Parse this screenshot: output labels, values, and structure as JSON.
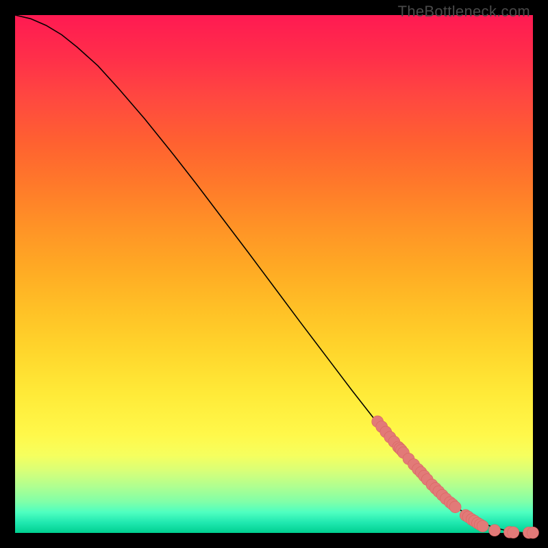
{
  "watermark": "TheBottleneck.com",
  "chart_data": {
    "type": "line",
    "title": "",
    "xlabel": "",
    "ylabel": "",
    "xlim": [
      0,
      100
    ],
    "ylim": [
      0,
      100
    ],
    "grid": false,
    "curve_x": [
      0,
      3,
      6,
      9,
      12,
      16,
      20,
      25,
      30,
      35,
      40,
      45,
      50,
      55,
      60,
      65,
      70,
      75,
      80,
      83,
      86,
      89,
      92,
      95,
      98,
      100
    ],
    "curve_y": [
      100,
      99.3,
      98.0,
      96.2,
      93.8,
      90.2,
      85.8,
      80.0,
      73.8,
      67.4,
      60.8,
      54.2,
      47.5,
      40.8,
      34.2,
      27.6,
      21.2,
      15.2,
      9.6,
      6.8,
      4.4,
      2.6,
      1.2,
      0.4,
      0.05,
      0.02
    ],
    "scatter_x": [
      70.0,
      70.8,
      71.6,
      72.4,
      73.2,
      74.0,
      74.3,
      74.6,
      75.0,
      76.0,
      77.0,
      77.8,
      78.4,
      79.0,
      79.6,
      80.5,
      81.2,
      81.8,
      82.5,
      83.2,
      84.0,
      84.5,
      85.0,
      87.0,
      87.5,
      88.2,
      88.7,
      89.3,
      89.8,
      90.3,
      92.6,
      95.5,
      96.2,
      99.2,
      100.0
    ],
    "scatter_y": [
      21.5,
      20.5,
      19.5,
      18.5,
      17.6,
      16.6,
      16.3,
      16.0,
      15.5,
      14.3,
      13.2,
      12.3,
      11.7,
      11.0,
      10.3,
      9.3,
      8.6,
      8.0,
      7.3,
      6.6,
      5.9,
      5.5,
      5.0,
      3.4,
      3.1,
      2.6,
      2.3,
      1.9,
      1.6,
      1.3,
      0.5,
      0.15,
      0.1,
      0.05,
      0.05
    ]
  },
  "colors": {
    "background": "#000000",
    "curve": "#000000",
    "dot_fill": "#e27a78",
    "dot_stroke": "#d8635f"
  }
}
